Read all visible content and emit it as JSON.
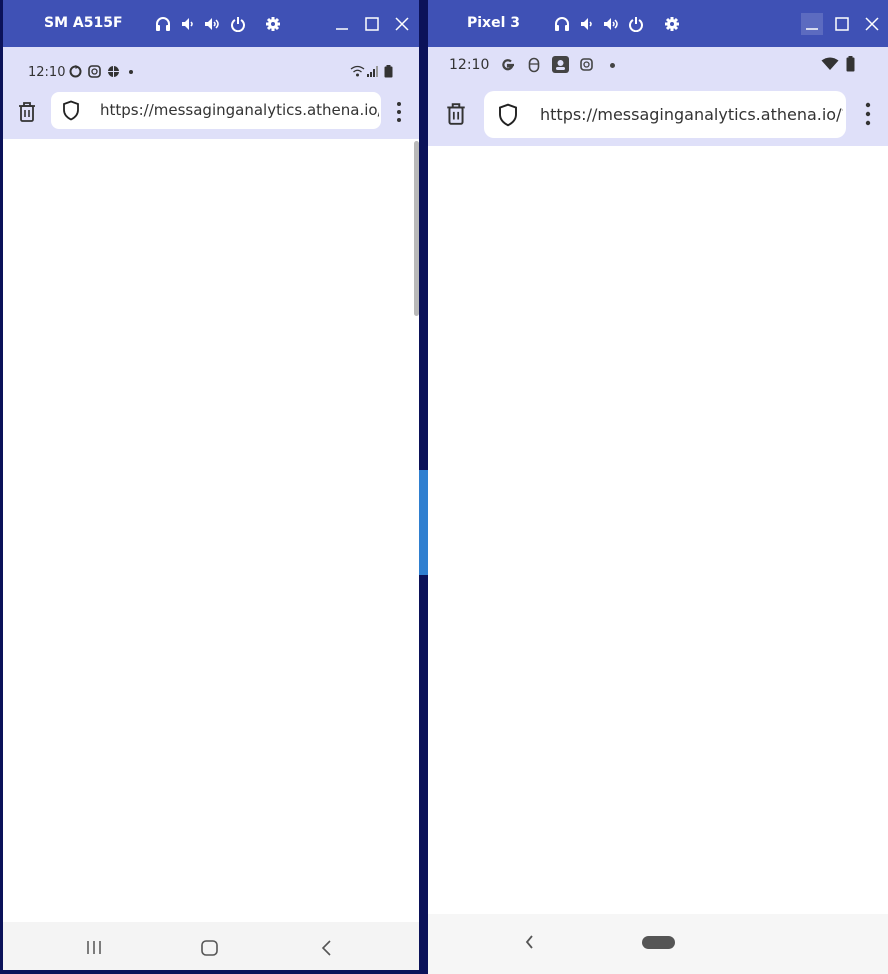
{
  "devices": [
    {
      "name": "SM A515F",
      "status_time": "12:10",
      "url": "https://messaginganalytics.athena.io/",
      "nav": [
        "recent-apps",
        "home",
        "back"
      ]
    },
    {
      "name": "Pixel 3",
      "status_time": "12:10",
      "url": "https://messaginganalytics.athena.io/?",
      "nav": [
        "back",
        "home-pill"
      ]
    }
  ],
  "colors": {
    "titlebar": "#3f51b5",
    "statusbar": "#dfe0f9",
    "background": "#0b1259"
  }
}
